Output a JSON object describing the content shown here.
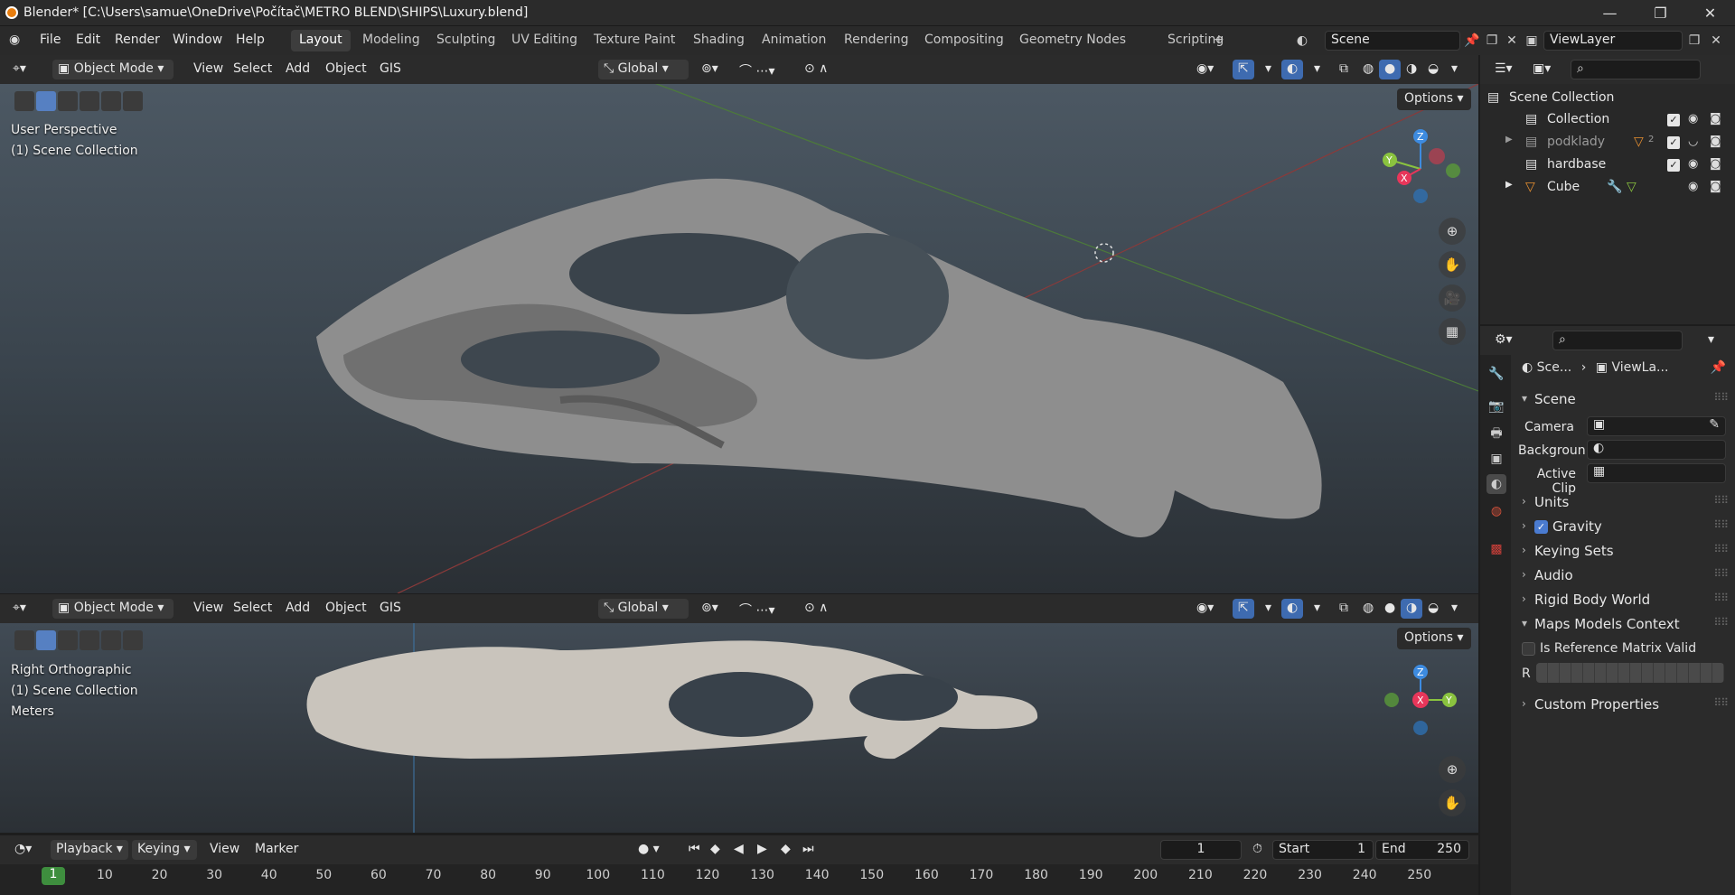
{
  "titlebar": {
    "title": "Blender* [C:\\Users\\samue\\OneDrive\\Počítač\\METRO BLEND\\SHIPS\\Luxury.blend]"
  },
  "menus": [
    "File",
    "Edit",
    "Render",
    "Window",
    "Help"
  ],
  "workspaces": [
    "Layout",
    "Modeling",
    "Sculpting",
    "UV Editing",
    "Texture Paint",
    "Shading",
    "Animation",
    "Rendering",
    "Compositing",
    "Geometry Nodes",
    "Scripting"
  ],
  "active_workspace": "Layout",
  "scene_field": "Scene",
  "viewlayer_field": "ViewLayer",
  "viewport_top": {
    "mode": "Object Mode",
    "menus": [
      "View",
      "Select",
      "Add",
      "Object",
      "GIS"
    ],
    "orientation": "Global",
    "overlay_title": "User Perspective",
    "overlay_collection": "(1) Scene Collection",
    "options": "Options",
    "axes": {
      "z": "Z",
      "y": "Y",
      "x": "X"
    }
  },
  "viewport_bottom": {
    "mode": "Object Mode",
    "menus": [
      "View",
      "Select",
      "Add",
      "Object",
      "GIS"
    ],
    "orientation": "Global",
    "overlay_title": "Right Orthographic",
    "overlay_collection": "(1) Scene Collection",
    "overlay_units": "Meters",
    "options": "Options",
    "axes": {
      "z": "Z",
      "y": "Y",
      "x": "X"
    }
  },
  "timeline": {
    "menus": [
      "Playback",
      "Keying",
      "View",
      "Marker"
    ],
    "current_frame": "1",
    "start_label": "Start",
    "start": "1",
    "end_label": "End",
    "end": "250",
    "ruler": [
      "1",
      "10",
      "20",
      "30",
      "40",
      "50",
      "60",
      "70",
      "80",
      "90",
      "100",
      "110",
      "120",
      "130",
      "140",
      "150",
      "160",
      "170",
      "180",
      "190",
      "200",
      "210",
      "220",
      "230",
      "240",
      "250"
    ]
  },
  "outliner": {
    "root": "Scene Collection",
    "items": [
      {
        "name": "Collection",
        "dim": false
      },
      {
        "name": "podklady",
        "dim": true,
        "badge": "2"
      },
      {
        "name": "hardbase",
        "dim": false
      },
      {
        "name": "Cube",
        "dim": false
      }
    ]
  },
  "properties": {
    "breadcrumb_scene": "Sce...",
    "breadcrumb_layer": "ViewLa...",
    "scene_section": "Scene",
    "camera_label": "Camera",
    "background_label": "Backgroun...",
    "clip_label": "Active Clip",
    "sections": [
      "Units",
      "Gravity",
      "Keying Sets",
      "Audio",
      "Rigid Body World",
      "Maps Models Context"
    ],
    "ref_matrix_label": "Is Reference Matrix Valid",
    "r_label": "R",
    "custom_props": "Custom Properties"
  },
  "colors": {
    "accent": "#5680c2",
    "x_axis": "#e8365a",
    "y_axis": "#8ac33f",
    "z_axis": "#3d8be0",
    "frame": "#3e8e3e"
  }
}
